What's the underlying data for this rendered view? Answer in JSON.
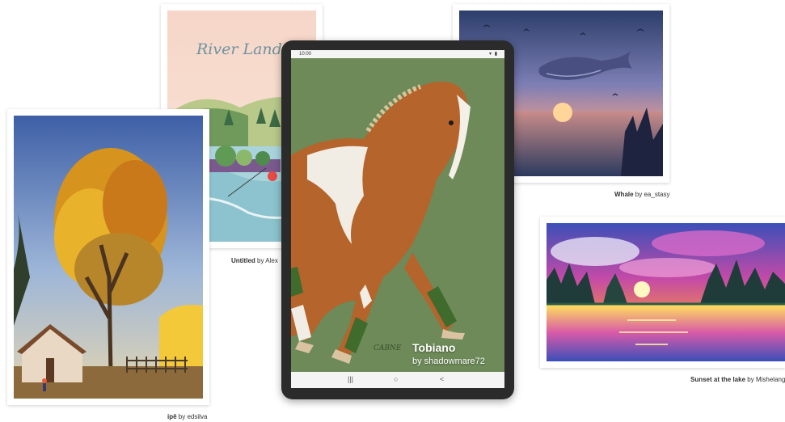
{
  "gallery": {
    "cards": [
      {
        "title": "Untitled",
        "by": "by",
        "artist": "Alex",
        "art_text": "River Landscape"
      },
      {
        "title": "Whale",
        "by": "by",
        "artist": "ea_stasy"
      },
      {
        "title": "ipê",
        "by": "by",
        "artist": "edsilva"
      },
      {
        "title": "Sunset at the lake",
        "by": "by",
        "artist": "Mishelangello"
      }
    ]
  },
  "tablet": {
    "status_time": "10:00",
    "status_icons": "▾ ▮",
    "artwork_title": "Tobiano",
    "artwork_credit": "by shadowmare72",
    "signature": "CABNE",
    "nav_recents": "|||",
    "nav_home": "○",
    "nav_back": "<"
  },
  "colors": {
    "tablet_bezel": "#2b2b2b",
    "tablet_background": "#6d8a58"
  }
}
